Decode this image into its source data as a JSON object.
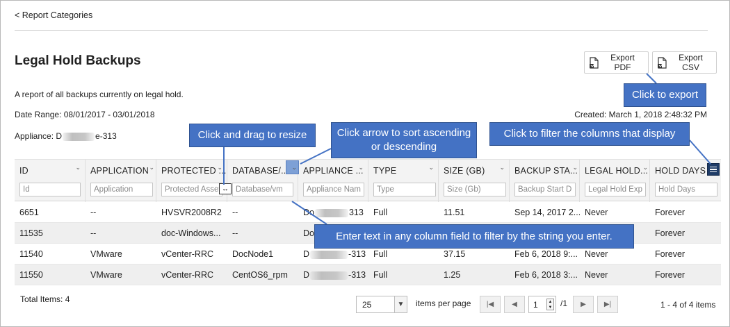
{
  "nav": {
    "back_label": "< Report Categories"
  },
  "report": {
    "title": "Legal Hold Backups",
    "description": "A report of all backups currently on legal hold.",
    "date_range": "Date Range: 08/01/2017 - 03/01/2018",
    "appliance_prefix": "Appliance: D",
    "appliance_suffix": "e-313",
    "created": "Created: March 1, 2018 2:48:32 PM"
  },
  "export": {
    "pdf_label": "Export PDF",
    "csv_label": "Export CSV"
  },
  "callouts": {
    "resize": "Click and drag to resize",
    "sort": "Click arrow to sort ascending or descending",
    "filter_columns": "Click to filter the columns that display",
    "export": "Click to export",
    "filter_text": "Enter text in any column field to filter by the string you enter."
  },
  "columns": [
    {
      "header": "ID",
      "placeholder": "Id"
    },
    {
      "header": "APPLICATION",
      "placeholder": "Application"
    },
    {
      "header": "PROTECTED ...",
      "placeholder": "Protected Asset"
    },
    {
      "header": "DATABASE/...",
      "placeholder": "Database/vm"
    },
    {
      "header": "APPLIANCE ...",
      "placeholder": "Appliance Name"
    },
    {
      "header": "TYPE",
      "placeholder": "Type"
    },
    {
      "header": "SIZE (GB)",
      "placeholder": "Size (Gb)"
    },
    {
      "header": "BACKUP STA...",
      "placeholder": "Backup Start Da"
    },
    {
      "header": "LEGAL HOLD...",
      "placeholder": "Legal Hold Expi"
    },
    {
      "header": "HOLD DAYS",
      "placeholder": "Hold Days"
    }
  ],
  "rows": [
    {
      "id": "6651",
      "application": "--",
      "protected": "HVSVR2008R2",
      "database": "--",
      "appliance_prefix": "Do",
      "appliance_suffix": "313",
      "type": "Full",
      "size": "11.51",
      "backup_start": "Sep 14, 2017 2...",
      "legal_hold": "Never",
      "hold_days": "Forever"
    },
    {
      "id": "11535",
      "application": "--",
      "protected": "doc-Windows...",
      "database": "--",
      "appliance_prefix": "Do",
      "appliance_suffix": "",
      "type": "",
      "size": "",
      "backup_start": "",
      "legal_hold": "",
      "hold_days": "Forever"
    },
    {
      "id": "11540",
      "application": "VMware",
      "protected": "vCenter-RRC",
      "database": "DocNode1",
      "appliance_prefix": "D",
      "appliance_suffix": "-313",
      "type": "Full",
      "size": "37.15",
      "backup_start": "Feb 6, 2018 9:...",
      "legal_hold": "Never",
      "hold_days": "Forever"
    },
    {
      "id": "11550",
      "application": "VMware",
      "protected": "vCenter-RRC",
      "database": "CentOS6_rpm",
      "appliance_prefix": "D",
      "appliance_suffix": "-313",
      "type": "Full",
      "size": "1.25",
      "backup_start": "Feb 6, 2018 3:...",
      "legal_hold": "Never",
      "hold_days": "Forever"
    }
  ],
  "footer": {
    "total_items": "Total Items: 4",
    "page_size": "25",
    "items_per_page": "items per page",
    "current_page": "1",
    "page_of": "/1",
    "count_label": "1 - 4 of 4 items"
  },
  "colors": {
    "callout_bg": "#4472c4",
    "menu_button": "#1f3c67",
    "header_bg": "#f3f3f3"
  }
}
